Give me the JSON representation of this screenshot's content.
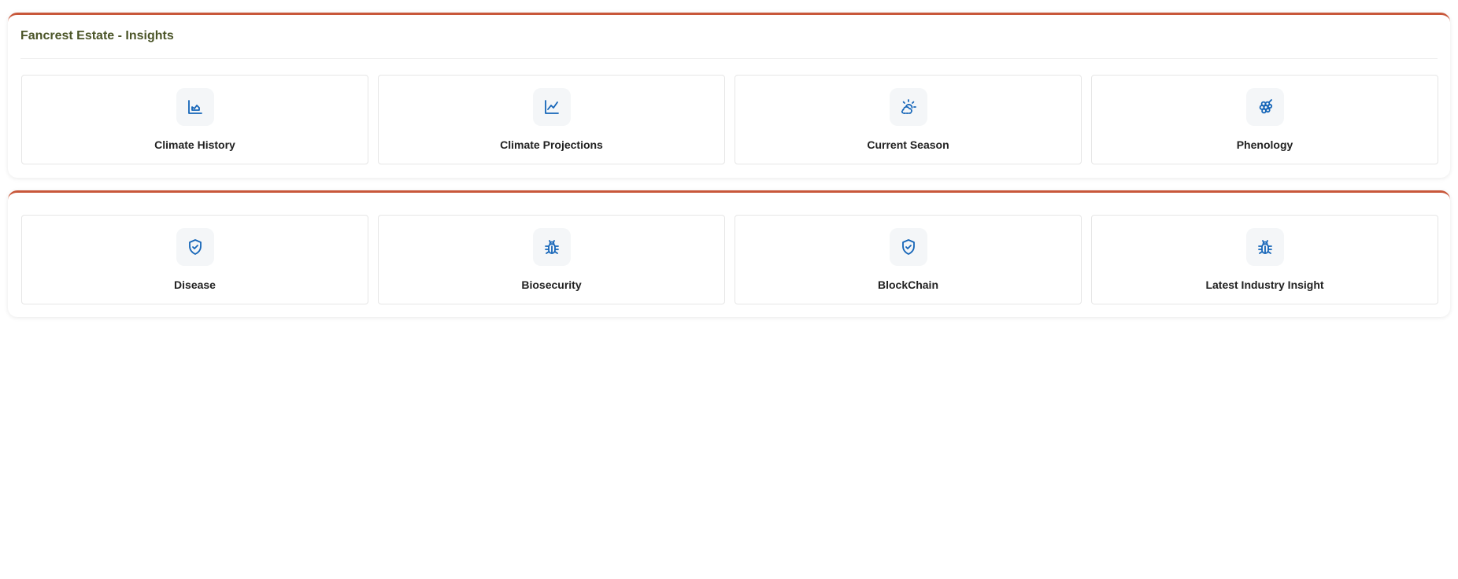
{
  "insights": {
    "title": "Fancrest Estate - Insights",
    "cards": [
      {
        "label": "Climate History",
        "icon": "area-chart-icon"
      },
      {
        "label": "Climate Projections",
        "icon": "line-chart-icon"
      },
      {
        "label": "Current Season",
        "icon": "sun-cloud-icon"
      },
      {
        "label": "Phenology",
        "icon": "grapes-icon"
      }
    ]
  },
  "risks": {
    "cards": [
      {
        "label": "Disease",
        "icon": "shield-check-icon"
      },
      {
        "label": "Biosecurity",
        "icon": "bug-icon"
      },
      {
        "label": "BlockChain",
        "icon": "shield-check-icon"
      },
      {
        "label": "Latest Industry Insight",
        "icon": "bug-icon"
      }
    ]
  },
  "colors": {
    "accent_border": "#c8573a",
    "title": "#4b5528",
    "icon": "#1565b8"
  }
}
